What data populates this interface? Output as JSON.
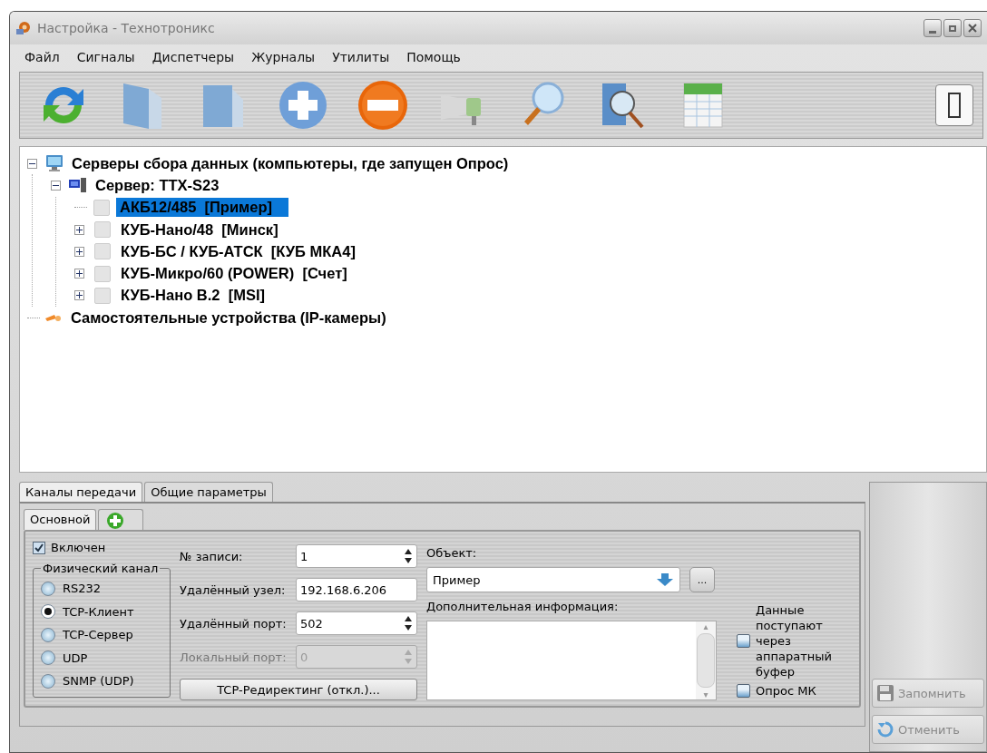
{
  "window": {
    "title": "Настройка - Технотроникс"
  },
  "menu": [
    {
      "label": "Файл"
    },
    {
      "label": "Сигналы"
    },
    {
      "label": "Диспетчеры"
    },
    {
      "label": "Журналы"
    },
    {
      "label": "Утилиты"
    },
    {
      "label": "Помощь"
    }
  ],
  "tree": [
    {
      "kind": "computers",
      "label": "Серверы сбора данных (компьютеры, где запущен Опрос)",
      "expanded": true,
      "selected": false,
      "children": [
        {
          "kind": "server",
          "label": "Сервер: TTX-S23",
          "expanded": true,
          "selected": false,
          "children": [
            {
              "kind": "device",
              "label": "АКБ12/485  [Пример]",
              "selected": true
            },
            {
              "kind": "device",
              "label": "КУБ-Нано/48  [Минск]",
              "expanded": false,
              "selected": false
            },
            {
              "kind": "device",
              "label": "КУБ-БС / КУБ-АТСК  [КУБ МКА4]",
              "expanded": false,
              "selected": false
            },
            {
              "kind": "device",
              "label": "КУБ-Микро/60 (POWER)  [Счет]",
              "expanded": false,
              "selected": false
            },
            {
              "kind": "device",
              "label": "КУБ-Нано B.2  [MSI]",
              "expanded": false,
              "selected": false
            }
          ]
        }
      ]
    },
    {
      "kind": "cameras",
      "label": "Самостоятельные устройства (IP-камеры)",
      "selected": false
    }
  ],
  "tabs": [
    {
      "label": "Каналы передачи",
      "selected": true
    },
    {
      "label": "Общие параметры",
      "selected": false
    }
  ],
  "subtabs": [
    {
      "label": "Основной",
      "selected": true
    }
  ],
  "enabled": {
    "label": "Включен",
    "checked": true
  },
  "channel_group": {
    "title": "Физический канал",
    "options": [
      {
        "label": "RS232",
        "selected": false
      },
      {
        "label": "TCP-Клиент",
        "selected": true
      },
      {
        "label": "TCP-Сервер",
        "selected": false
      },
      {
        "label": "UDP",
        "selected": false
      },
      {
        "label": "SNMP (UDP)",
        "selected": false
      }
    ]
  },
  "fields": [
    {
      "label": "№ записи:",
      "value": "1",
      "kind": "spin",
      "disabled": false
    },
    {
      "label": "Удалённый узел:",
      "value": "192.168.6.206",
      "kind": "text",
      "disabled": false
    },
    {
      "label": "Удалённый порт:",
      "value": "502",
      "kind": "spin",
      "disabled": false
    },
    {
      "label": "Локальный порт:",
      "value": "0",
      "kind": "spin",
      "disabled": true
    }
  ],
  "redirect_button": {
    "label": "TCP-Редиректинг (откл.)..."
  },
  "object": {
    "label": "Объект:",
    "value": "Пример",
    "browse_label": "..."
  },
  "info": {
    "label": "Дополнительная информация:",
    "scroll_up": "▴",
    "scroll_down": "▾"
  },
  "options": [
    {
      "label": "Данные поступают через аппаратный буфер",
      "checked": false
    },
    {
      "label": "Опрос МК",
      "checked": false
    }
  ],
  "actions": [
    {
      "kind": "save",
      "label": "Запомнить",
      "disabled": true
    },
    {
      "kind": "cancel",
      "label": "Отменить",
      "disabled": true
    }
  ]
}
